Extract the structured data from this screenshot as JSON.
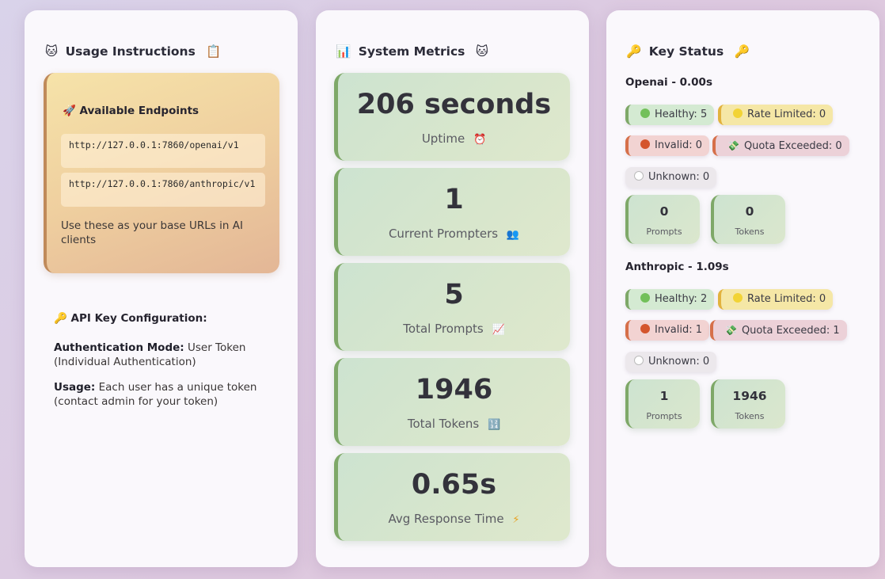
{
  "usage": {
    "title": "Usage Instructions",
    "title_icon": "cat-face-icon",
    "title_icon_right": "clipboard-icon",
    "endpoints_title": "Available Endpoints",
    "endpoints_icon": "rocket-icon",
    "endpoints": [
      "http://127.0.0.1:7860/openai/v1",
      "http://127.0.0.1:7860/anthropic/v1"
    ],
    "endpoints_note": "Use these as your base URLs in AI clients",
    "api_config_title": "API Key Configuration:",
    "api_config_icon": "key-icon",
    "auth_mode_label": "Authentication Mode:",
    "auth_mode_value": "User Token (Individual Authentication)",
    "usage_label": "Usage:",
    "usage_value": "Each user has a unique token (contact admin for your token)"
  },
  "metrics": {
    "title": "System Metrics",
    "title_icon": "bar-chart-icon",
    "title_icon_right": "cat-face-icon",
    "cards": [
      {
        "value": "206 seconds",
        "label": "Uptime",
        "icon": "alarm-clock-icon"
      },
      {
        "value": "1",
        "label": "Current Prompters",
        "icon": "people-icon"
      },
      {
        "value": "5",
        "label": "Total Prompts",
        "icon": "trending-chart-icon"
      },
      {
        "value": "1946",
        "label": "Total Tokens",
        "icon": "input-numbers-icon"
      },
      {
        "value": "0.65s",
        "label": "Avg Response Time",
        "icon": "lightning-icon"
      }
    ]
  },
  "keys": {
    "title": "Key Status",
    "title_icon": "key-icon",
    "providers": [
      {
        "name": "Openai - 0.00s",
        "healthy": "Healthy: 5",
        "rate_limited": "Rate Limited: 0",
        "invalid": "Invalid: 0",
        "quota": "Quota Exceeded: 0",
        "unknown": "Unknown: 0",
        "prompts_value": "0",
        "prompts_label": "Prompts",
        "tokens_value": "0",
        "tokens_label": "Tokens"
      },
      {
        "name": "Anthropic - 1.09s",
        "healthy": "Healthy: 2",
        "rate_limited": "Rate Limited: 0",
        "invalid": "Invalid: 1",
        "quota": "Quota Exceeded: 1",
        "unknown": "Unknown: 0",
        "prompts_value": "1",
        "prompts_label": "Prompts",
        "tokens_value": "1946",
        "tokens_label": "Tokens"
      }
    ]
  },
  "colors": {
    "accent_green": "#7ea868",
    "healthy": "#72c05a",
    "rate_limited": "#f2d335",
    "invalid": "#d4552d",
    "endpoint_border": "#c08a5a"
  }
}
